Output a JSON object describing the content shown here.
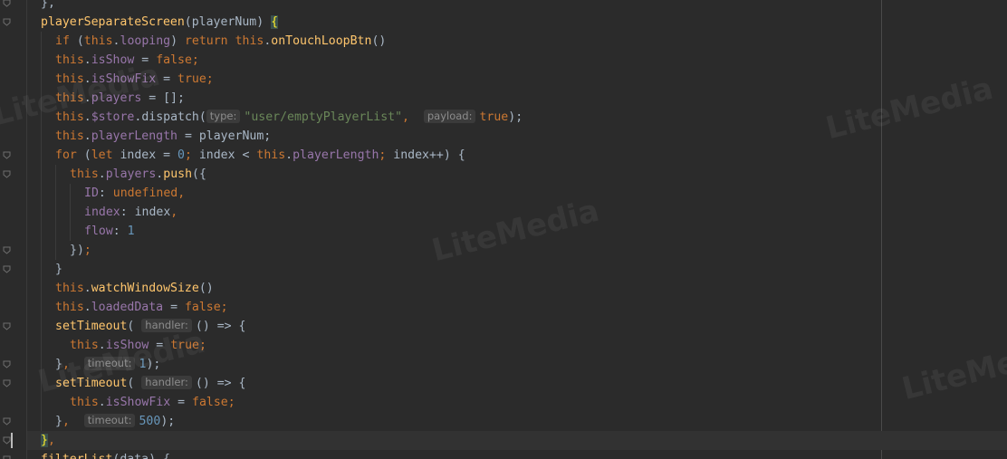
{
  "editor": {
    "lines": [
      {
        "indent": 0,
        "tokens": [
          {
            "t": "},",
            "c": "plain"
          }
        ]
      },
      {
        "indent": 0,
        "tokens": [
          {
            "t": "playerSeparateScreen",
            "c": "fn"
          },
          {
            "t": "(playerNum) ",
            "c": "plain"
          },
          {
            "t": "{",
            "c": "brace-hl"
          }
        ]
      },
      {
        "indent": 1,
        "tokens": [
          {
            "t": "if",
            "c": "kw"
          },
          {
            "t": " (",
            "c": "plain"
          },
          {
            "t": "this",
            "c": "kw"
          },
          {
            "t": ".",
            "c": "plain"
          },
          {
            "t": "looping",
            "c": "prop"
          },
          {
            "t": ") ",
            "c": "plain"
          },
          {
            "t": "return",
            "c": "kw"
          },
          {
            "t": " ",
            "c": "plain"
          },
          {
            "t": "this",
            "c": "kw"
          },
          {
            "t": ".",
            "c": "plain"
          },
          {
            "t": "onTouchLoopBtn",
            "c": "fn"
          },
          {
            "t": "()",
            "c": "plain"
          }
        ]
      },
      {
        "indent": 1,
        "tokens": [
          {
            "t": "this",
            "c": "kw"
          },
          {
            "t": ".",
            "c": "plain"
          },
          {
            "t": "isShow",
            "c": "prop"
          },
          {
            "t": " = ",
            "c": "plain"
          },
          {
            "t": "false",
            "c": "kw"
          },
          {
            "t": ";",
            "c": "punc"
          }
        ]
      },
      {
        "indent": 1,
        "tokens": [
          {
            "t": "this",
            "c": "kw"
          },
          {
            "t": ".",
            "c": "plain"
          },
          {
            "t": "isShowFix",
            "c": "prop"
          },
          {
            "t": " = ",
            "c": "plain"
          },
          {
            "t": "true",
            "c": "kw"
          },
          {
            "t": ";",
            "c": "punc"
          }
        ]
      },
      {
        "indent": 1,
        "tokens": [
          {
            "t": "this",
            "c": "kw"
          },
          {
            "t": ".",
            "c": "plain"
          },
          {
            "t": "players",
            "c": "prop"
          },
          {
            "t": " = [];",
            "c": "plain"
          }
        ]
      },
      {
        "indent": 1,
        "tokens": [
          {
            "t": "this",
            "c": "kw"
          },
          {
            "t": ".",
            "c": "plain"
          },
          {
            "t": "$store",
            "c": "prop"
          },
          {
            "t": ".",
            "c": "plain"
          },
          {
            "t": "dispatch",
            "c": "plain"
          },
          {
            "t": "(",
            "c": "plain"
          },
          {
            "hint": "type:"
          },
          {
            "t": "\"user/emptyPlayerList\"",
            "c": "str"
          },
          {
            "t": ",  ",
            "c": "punc"
          },
          {
            "hint": "payload:"
          },
          {
            "t": "true",
            "c": "kw"
          },
          {
            "t": ");",
            "c": "plain"
          }
        ]
      },
      {
        "indent": 1,
        "tokens": [
          {
            "t": "this",
            "c": "kw"
          },
          {
            "t": ".",
            "c": "plain"
          },
          {
            "t": "playerLength",
            "c": "prop"
          },
          {
            "t": " = playerNum;",
            "c": "plain"
          }
        ]
      },
      {
        "indent": 1,
        "tokens": [
          {
            "t": "for",
            "c": "kw"
          },
          {
            "t": " (",
            "c": "plain"
          },
          {
            "t": "let",
            "c": "kw"
          },
          {
            "t": " index = ",
            "c": "plain"
          },
          {
            "t": "0",
            "c": "num"
          },
          {
            "t": "; ",
            "c": "punc"
          },
          {
            "t": "index < ",
            "c": "plain"
          },
          {
            "t": "this",
            "c": "kw"
          },
          {
            "t": ".",
            "c": "plain"
          },
          {
            "t": "playerLength",
            "c": "prop"
          },
          {
            "t": "; ",
            "c": "punc"
          },
          {
            "t": "index++) {",
            "c": "plain"
          }
        ]
      },
      {
        "indent": 2,
        "tokens": [
          {
            "t": "this",
            "c": "kw"
          },
          {
            "t": ".",
            "c": "plain"
          },
          {
            "t": "players",
            "c": "prop"
          },
          {
            "t": ".",
            "c": "plain"
          },
          {
            "t": "push",
            "c": "fn"
          },
          {
            "t": "({",
            "c": "plain"
          }
        ]
      },
      {
        "indent": 3,
        "tokens": [
          {
            "t": "ID",
            "c": "prop"
          },
          {
            "t": ": ",
            "c": "plain"
          },
          {
            "t": "undefined",
            "c": "kw"
          },
          {
            "t": ",",
            "c": "punc"
          }
        ]
      },
      {
        "indent": 3,
        "tokens": [
          {
            "t": "index",
            "c": "prop"
          },
          {
            "t": ": index",
            "c": "plain"
          },
          {
            "t": ",",
            "c": "punc"
          }
        ]
      },
      {
        "indent": 3,
        "tokens": [
          {
            "t": "flow",
            "c": "prop"
          },
          {
            "t": ": ",
            "c": "plain"
          },
          {
            "t": "1",
            "c": "num"
          }
        ]
      },
      {
        "indent": 2,
        "tokens": [
          {
            "t": "})",
            "c": "plain"
          },
          {
            "t": ";",
            "c": "punc"
          }
        ]
      },
      {
        "indent": 1,
        "tokens": [
          {
            "t": "}",
            "c": "plain"
          }
        ]
      },
      {
        "indent": 1,
        "tokens": [
          {
            "t": "this",
            "c": "kw"
          },
          {
            "t": ".",
            "c": "plain"
          },
          {
            "t": "watchWindowSize",
            "c": "fn"
          },
          {
            "t": "()",
            "c": "plain"
          }
        ]
      },
      {
        "indent": 1,
        "tokens": [
          {
            "t": "this",
            "c": "kw"
          },
          {
            "t": ".",
            "c": "plain"
          },
          {
            "t": "loadedData",
            "c": "prop"
          },
          {
            "t": " = ",
            "c": "plain"
          },
          {
            "t": "false",
            "c": "kw"
          },
          {
            "t": ";",
            "c": "punc"
          }
        ]
      },
      {
        "indent": 1,
        "tokens": [
          {
            "t": "setTimeout",
            "c": "fn"
          },
          {
            "t": "( ",
            "c": "plain"
          },
          {
            "hint": "handler:"
          },
          {
            "t": "() => {",
            "c": "plain"
          }
        ]
      },
      {
        "indent": 2,
        "tokens": [
          {
            "t": "this",
            "c": "kw"
          },
          {
            "t": ".",
            "c": "plain"
          },
          {
            "t": "isShow",
            "c": "prop"
          },
          {
            "t": " = ",
            "c": "plain"
          },
          {
            "t": "true",
            "c": "kw"
          },
          {
            "t": ";",
            "c": "punc"
          }
        ]
      },
      {
        "indent": 1,
        "tokens": [
          {
            "t": "}",
            "c": "plain"
          },
          {
            "t": ",  ",
            "c": "punc"
          },
          {
            "hint": "timeout:"
          },
          {
            "t": "1",
            "c": "num"
          },
          {
            "t": ");",
            "c": "plain"
          }
        ]
      },
      {
        "indent": 1,
        "tokens": [
          {
            "t": "setTimeout",
            "c": "fn"
          },
          {
            "t": "( ",
            "c": "plain"
          },
          {
            "hint": "handler:"
          },
          {
            "t": "() => {",
            "c": "plain"
          }
        ]
      },
      {
        "indent": 2,
        "tokens": [
          {
            "t": "this",
            "c": "kw"
          },
          {
            "t": ".",
            "c": "plain"
          },
          {
            "t": "isShowFix",
            "c": "prop"
          },
          {
            "t": " = ",
            "c": "plain"
          },
          {
            "t": "false",
            "c": "kw"
          },
          {
            "t": ";",
            "c": "punc"
          }
        ]
      },
      {
        "indent": 1,
        "tokens": [
          {
            "t": "}",
            "c": "plain"
          },
          {
            "t": ",  ",
            "c": "punc"
          },
          {
            "hint": "timeout:"
          },
          {
            "t": "500",
            "c": "num"
          },
          {
            "t": ");",
            "c": "plain"
          }
        ]
      },
      {
        "indent": 0,
        "tokens": [
          {
            "t": "}",
            "c": "brace-hl"
          },
          {
            "t": ",",
            "c": "punc"
          }
        ]
      },
      {
        "indent": 0,
        "tokens": [
          {
            "t": "filterList",
            "c": "fn"
          },
          {
            "t": "(data) {",
            "c": "plain"
          }
        ]
      }
    ]
  },
  "watermarks": [
    "LiteMedia",
    "LiteMedia",
    "LiteMedia",
    "LiteMe",
    "LiteMedia"
  ],
  "colors": {
    "background": "#2b2b2b",
    "keyword": "#cc7832",
    "property": "#9876aa",
    "function": "#ffc66d",
    "string": "#6a8759",
    "number": "#6897bb",
    "text": "#a9b7c6"
  }
}
